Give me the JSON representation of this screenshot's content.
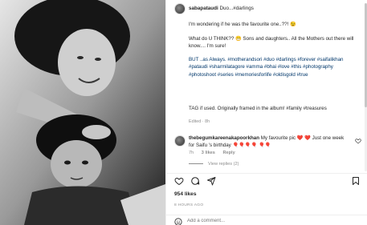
{
  "post": {
    "username": "sabapataudi",
    "caption_first": "Duo...#darlings",
    "caption_paragraphs": [
      "I'm wondering if he was the favourite one..??! 😉",
      "What do U THINK?? 😁 Sons and daughters.. All the Mothers out there will know.... I'm sure!",
      "BUT ..as Always. #motherandsori #duo #darlings #forever #saifalikhan #pataudi #sharmilatagore #amma #bhai #love #this #photography #photoshoot #series #memoriesforlife #oldisgold #true",
      "TAG if used. Originally framed in the album! #family #treasures"
    ],
    "edited_label": "Edited · 8h"
  },
  "comment": {
    "username": "thebegumkareenakapoorkhan",
    "text": "My favourite pic ❤️ ❤️ Just one week for Saifu 's birthday 🎈🎈🎈🎈 🎈🎈",
    "time": "7h",
    "likes": "3 likes",
    "reply": "Reply",
    "view_replies": "View replies (2)"
  },
  "actions": {
    "icons": [
      "heart-icon",
      "comment-icon",
      "share-icon",
      "bookmark-icon"
    ]
  },
  "likes_count": "954 likes",
  "timestamp": "8 HOURS AGO",
  "add_comment_placeholder": "Add a comment..."
}
